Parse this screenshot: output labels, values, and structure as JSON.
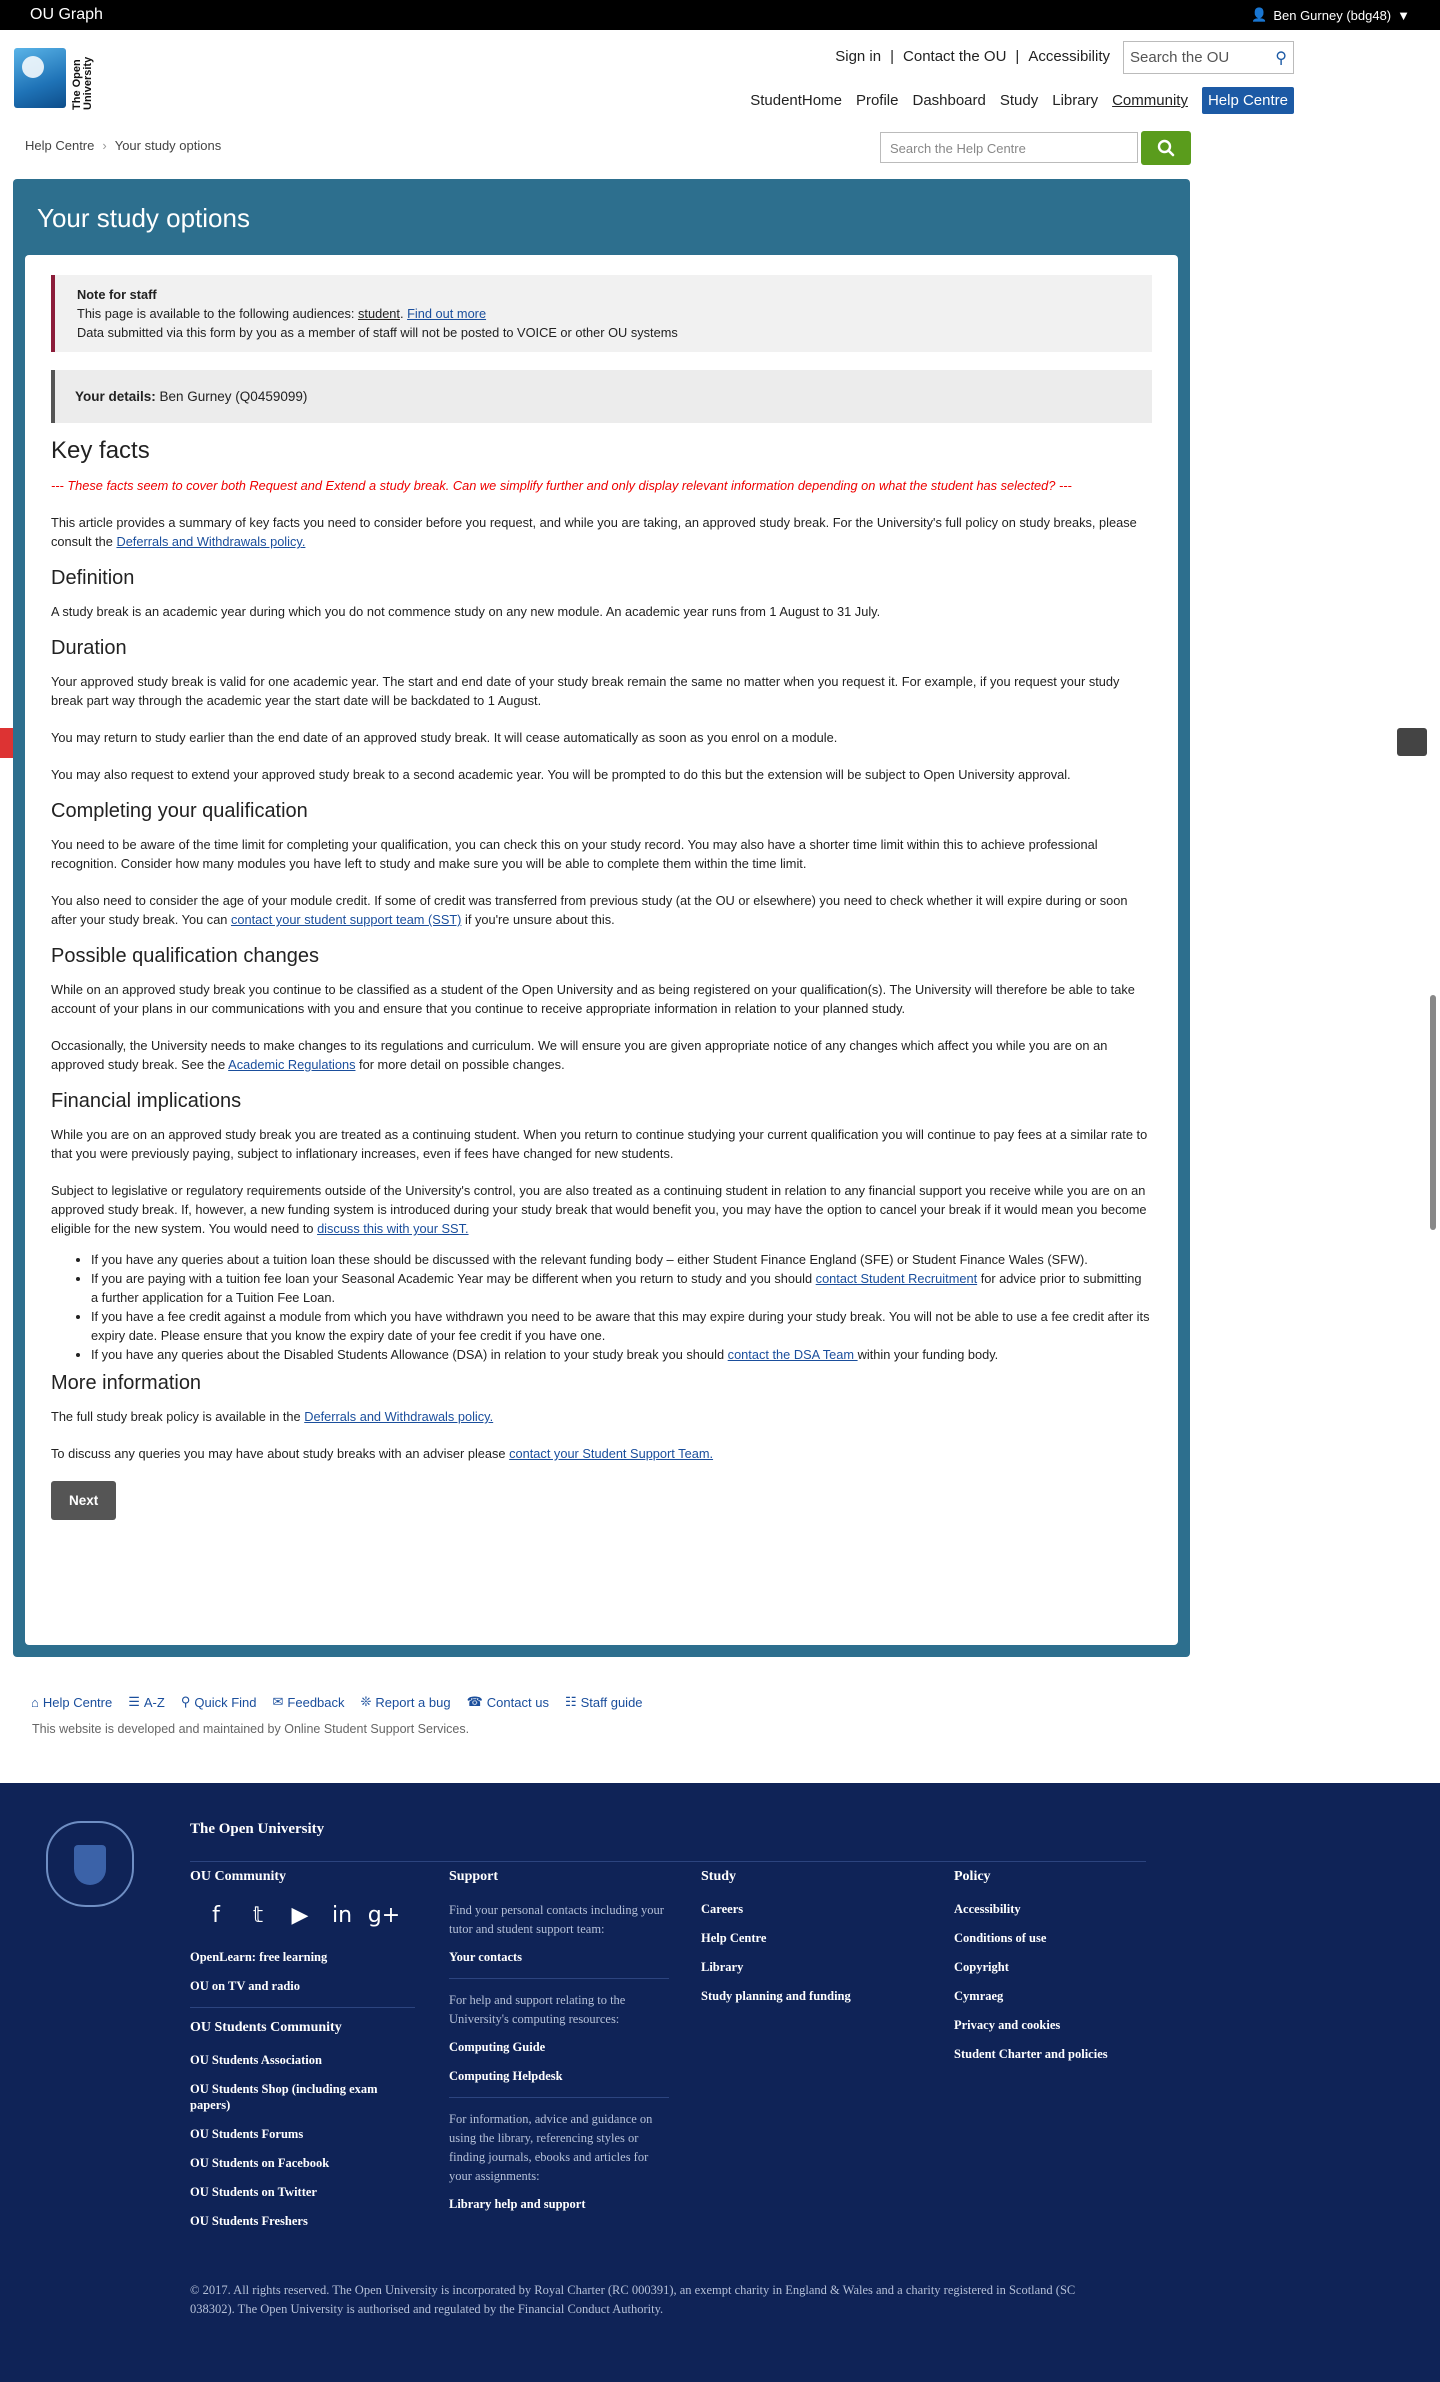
{
  "topbar": {
    "brand": "OU Graph",
    "user": "Ben Gurney (bdg48)"
  },
  "header": {
    "logo_text": "The Open University",
    "util_links": [
      "Sign in",
      "Contact the OU",
      "Accessibility"
    ],
    "search_placeholder": "Search the OU",
    "nav": [
      "StudentHome",
      "Profile",
      "Dashboard",
      "Study",
      "Library",
      "Community",
      "Help Centre"
    ]
  },
  "breadcrumb": [
    "Help Centre",
    "Your study options"
  ],
  "help_search": {
    "placeholder": "Search the Help Centre"
  },
  "page": {
    "title": "Your study options",
    "note": {
      "title": "Note for staff",
      "line1_pre": "This page is available to the following audiences: ",
      "line1_audience": "student",
      "line1_mid": ". ",
      "line1_link": "Find out more",
      "line2": "Data submitted via this form by you as a member of staff will not be posted to VOICE or other OU systems"
    },
    "details_label": "Your details:",
    "details_value": " Ben Gurney (Q0459099)",
    "key_facts": "Key facts",
    "red_note": "--- These facts seem to cover both Request and Extend a study break. Can we simplify further and only display relevant information depending on what the student has selected? ---",
    "intro_pre": "This article provides a summary of key facts you need to consider before you request, and while you are taking, an approved study break. For the University's full policy on study breaks, please consult the ",
    "intro_link": "Deferrals and Withdrawals policy.",
    "definition_h": "Definition",
    "definition_p": "A study break is an academic year during which you do not commence study on any new module. An academic year runs from 1 August to 31 July.",
    "duration_h": "Duration",
    "duration_p1": "Your approved study break is valid for one academic year. The start and end date of your study break remain the same no matter when you request it. For example, if you request your study break part way through the academic year the start date will be backdated to 1 August.",
    "duration_p2": "You may return to study earlier than the end date of an approved study break. It will cease automatically as soon as you enrol on a module.",
    "duration_p3": "You may also request to extend your approved study break to a second academic year. You will be prompted to do this but the extension will be subject to Open University approval.",
    "completing_h": "Completing your qualification",
    "completing_p1": "You need to be aware of the time limit for completing your qualification, you can check this on your study record. You may also have a shorter time limit within this to achieve professional recognition. Consider how many modules you have left to study and make sure you will be able to complete them within the time limit.",
    "completing_p2_pre": "You also need to consider the age of your module credit. If some of credit was transferred from previous study (at the OU or elsewhere) you need to check whether it will expire during or soon after your study break. You can ",
    "completing_p2_link": "contact your student support team (SST)",
    "completing_p2_post": " if you're unsure about this.",
    "possible_h": "Possible qualification changes",
    "possible_p1": "While on an approved study break you continue to be classified as a student of the Open University and as being registered on your qualification(s). The University will therefore be able to take account of your plans in our communications with you and ensure that you continue to receive appropriate information in relation to your planned study.",
    "possible_p2_pre": "Occasionally, the University needs to make changes to its regulations and curriculum. We will ensure you are given appropriate notice of any changes which affect you while you are on an approved study break. See the ",
    "possible_p2_link": "Academic Regulations",
    "possible_p2_post": " for more detail on possible changes.",
    "financial_h": "Financial implications",
    "financial_p1": "While you are on an approved study break you are treated as a continuing student. When you return to continue studying your current qualification you will continue to pay fees at a similar rate to that you were previously paying, subject to inflationary increases, even if fees have changed for new students.",
    "financial_p2_pre": "Subject to legislative or regulatory requirements outside of the University's control, you are also treated as a continuing student in relation to any financial support you receive while you are on an approved study break. If, however, a new funding system is introduced during your study break that would benefit you, you may have the option to cancel your break if it would mean you become eligible for the new system. You would need to ",
    "financial_p2_link": "discuss this with your SST.",
    "bullet1": "If you have any queries about a tuition loan these should be discussed with the relevant funding body – either Student Finance England (SFE) or Student Finance Wales (SFW).",
    "bullet2_pre": "If you are paying with a tuition fee loan your Seasonal Academic Year may be different when you return to study and you should ",
    "bullet2_link": "contact Student Recruitment",
    "bullet2_post": " for advice prior to submitting a further application for a Tuition Fee Loan.",
    "bullet3": "If you have a fee credit against a module from which you have withdrawn you need to be aware that this may expire during your study break. You will not be able to use a fee credit after its expiry date. Please ensure that you know the expiry date of your fee credit if you have one.",
    "bullet4_pre": "If you have any queries about the Disabled Students Allowance (DSA) in relation to your study break you should ",
    "bullet4_link": "contact the DSA Team ",
    "bullet4_post": "within your funding body.",
    "more_h": "More information",
    "more_p1_pre": "The full study break policy is available in the ",
    "more_p1_link": "Deferrals and Withdrawals policy.",
    "more_p2_pre": "To discuss any queries you may have about study breaks with an adviser please ",
    "more_p2_link": "contact your Student Support Team.",
    "next": "Next"
  },
  "footer_links": [
    "Help Centre",
    "A-Z",
    "Quick Find",
    "Feedback",
    "Report a bug",
    "Contact us",
    "Staff guide"
  ],
  "footer_note": "This website is developed and maintained by Online Student Support Services.",
  "footer": {
    "heading": "The Open University",
    "community_h": "OU Community",
    "community_items": [
      "OpenLearn: free learning",
      "OU on TV and radio"
    ],
    "students_h": "OU Students Community",
    "students_items": [
      "OU Students Association",
      "OU Students Shop (including exam papers)",
      "OU Students Forums",
      "OU Students on Facebook",
      "OU Students on Twitter",
      "OU Students Freshers"
    ],
    "support_h": "Support",
    "support_desc1": "Find your personal contacts including your tutor and student support team:",
    "support_link1": "Your contacts",
    "support_desc2": "For help and support relating to the University's computing resources:",
    "support_link2a": "Computing Guide",
    "support_link2b": "Computing Helpdesk",
    "support_desc3": "For information, advice and guidance on using the library, referencing styles or finding journals, ebooks and articles for your assignments:",
    "support_link3": "Library help and support",
    "study_h": "Study",
    "study_items": [
      "Careers",
      "Help Centre",
      "Library",
      "Study planning and funding"
    ],
    "policy_h": "Policy",
    "policy_items": [
      "Accessibility",
      "Conditions of use",
      "Copyright",
      "Cymraeg",
      "Privacy and cookies",
      "Student Charter and policies"
    ],
    "copyright": "© 2017. All rights reserved. The Open University is incorporated by Royal Charter (RC 000391), an exempt charity in England & Wales and a charity registered in Scotland (SC 038302). The Open University is authorised and regulated by the Financial Conduct Authority."
  }
}
